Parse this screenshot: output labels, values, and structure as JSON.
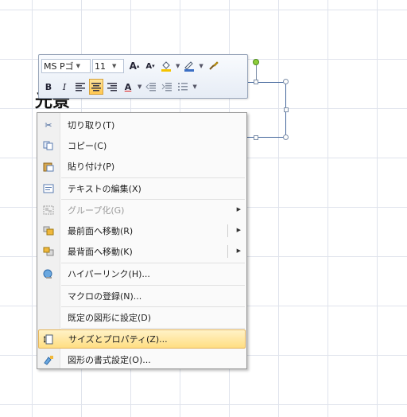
{
  "shape": {
    "text": "光景"
  },
  "mini_toolbar": {
    "font_name": "MS Pゴ",
    "font_size": "11",
    "grow_font": "A",
    "shrink_font": "A",
    "bold": "B",
    "italic": "I",
    "font_color_letter": "A",
    "font_color": "#e02020",
    "highlight_color": "#f5c400",
    "outline_color": "#3b6fc4"
  },
  "context_menu": {
    "items": [
      {
        "label": "切り取り(T)",
        "icon": "scissors-icon",
        "enabled": true
      },
      {
        "label": "コピー(C)",
        "icon": "copy-icon",
        "enabled": true
      },
      {
        "label": "貼り付け(P)",
        "icon": "paste-icon",
        "enabled": true
      },
      {
        "label": "テキストの編集(X)",
        "icon": "edit-text-icon",
        "enabled": true
      },
      {
        "label": "グループ化(G)",
        "icon": "group-icon",
        "enabled": false
      },
      {
        "label": "最前面へ移動(R)",
        "icon": "bring-to-front-icon",
        "enabled": true
      },
      {
        "label": "最背面へ移動(K)",
        "icon": "send-to-back-icon",
        "enabled": true
      },
      {
        "label": "ハイパーリンク(H)...",
        "icon": "hyperlink-icon",
        "enabled": true
      },
      {
        "label": "マクロの登録(N)...",
        "icon": "",
        "enabled": true
      },
      {
        "label": "既定の図形に設定(D)",
        "icon": "",
        "enabled": true
      },
      {
        "label": "サイズとプロパティ(Z)...",
        "icon": "size-properties-icon",
        "enabled": true,
        "highlighted": true
      },
      {
        "label": "図形の書式設定(O)...",
        "icon": "format-shape-icon",
        "enabled": true
      }
    ]
  }
}
